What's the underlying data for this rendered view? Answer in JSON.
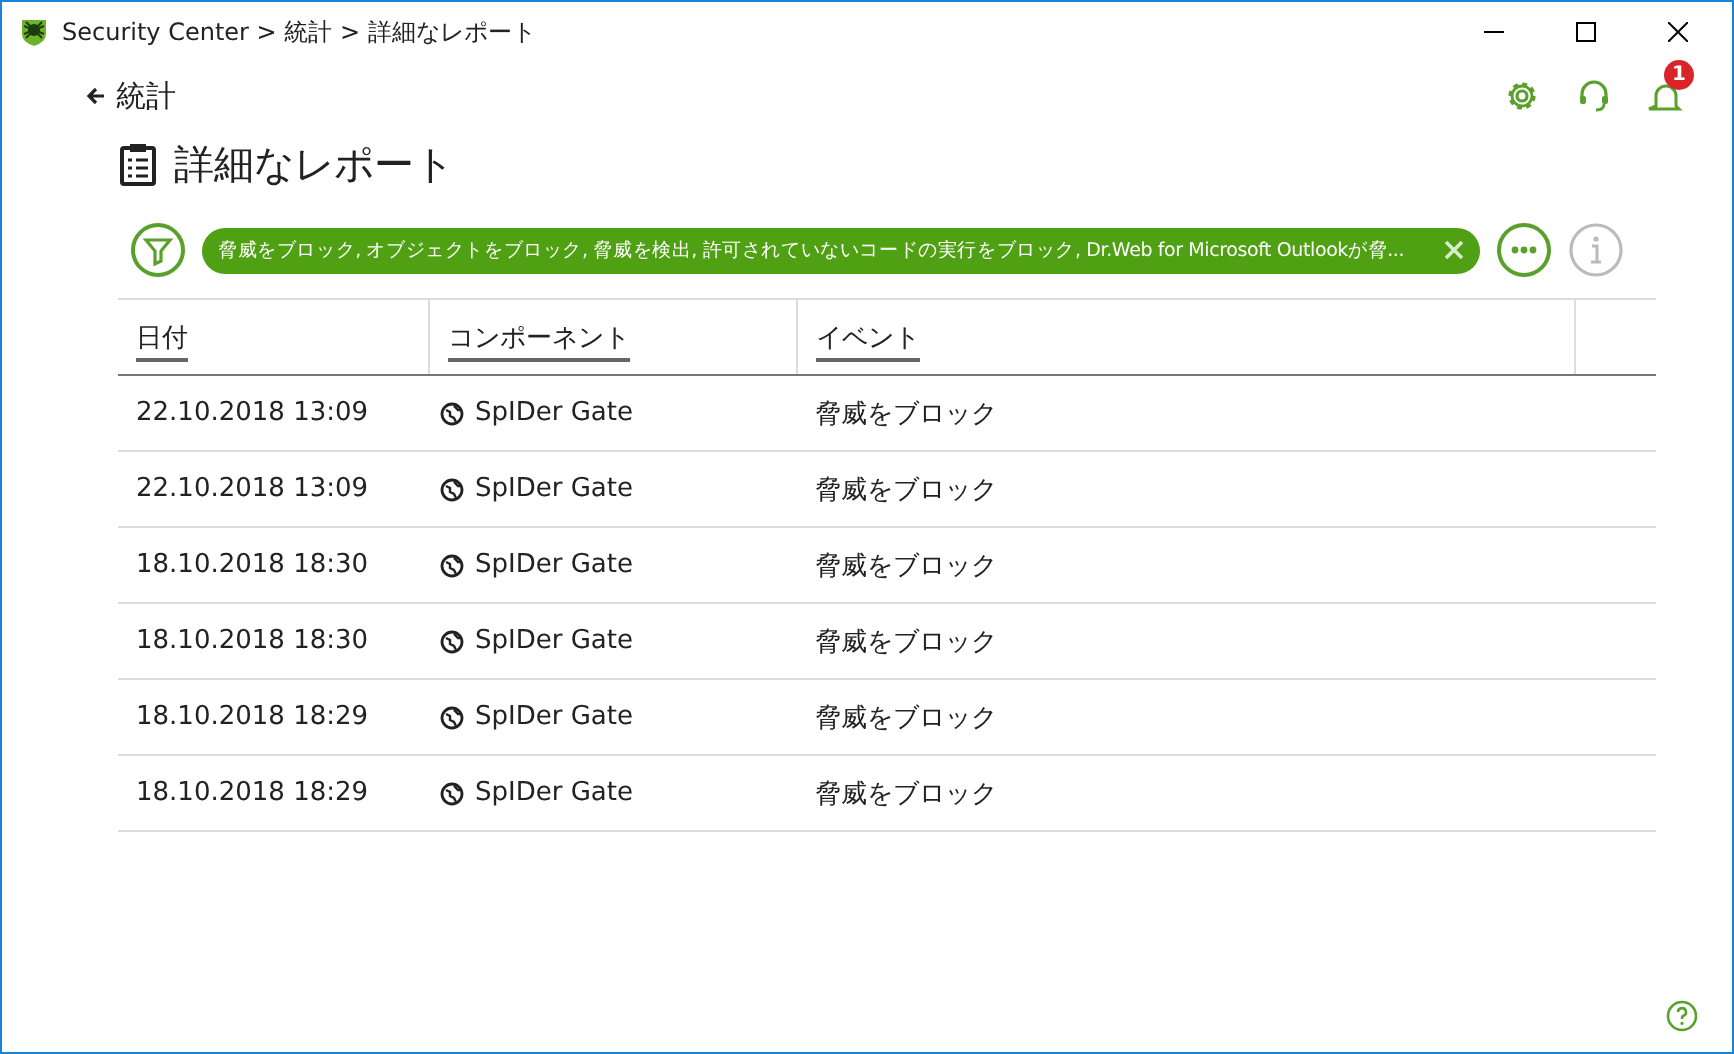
{
  "window": {
    "title": "Security Center > 統計 > 詳細なレポート"
  },
  "back_link": "統計",
  "notifications": {
    "badge": "1"
  },
  "page_title": "詳細なレポート",
  "filter": {
    "text": "脅威をブロック, オブジェクトをブロック, 脅威を検出, 許可されていないコードの実行をブロック, Dr.Web for Microsoft Outlookが脅..."
  },
  "table": {
    "columns": [
      "日付",
      "コンポーネント",
      "イベント"
    ],
    "rows": [
      {
        "date": "22.10.2018 13:09",
        "component": "SpIDer Gate",
        "event": "脅威をブロック"
      },
      {
        "date": "22.10.2018 13:09",
        "component": "SpIDer Gate",
        "event": "脅威をブロック"
      },
      {
        "date": "18.10.2018 18:30",
        "component": "SpIDer Gate",
        "event": "脅威をブロック"
      },
      {
        "date": "18.10.2018 18:30",
        "component": "SpIDer Gate",
        "event": "脅威をブロック"
      },
      {
        "date": "18.10.2018 18:29",
        "component": "SpIDer Gate",
        "event": "脅威をブロック"
      },
      {
        "date": "18.10.2018 18:29",
        "component": "SpIDer Gate",
        "event": "脅威をブロック"
      }
    ]
  }
}
